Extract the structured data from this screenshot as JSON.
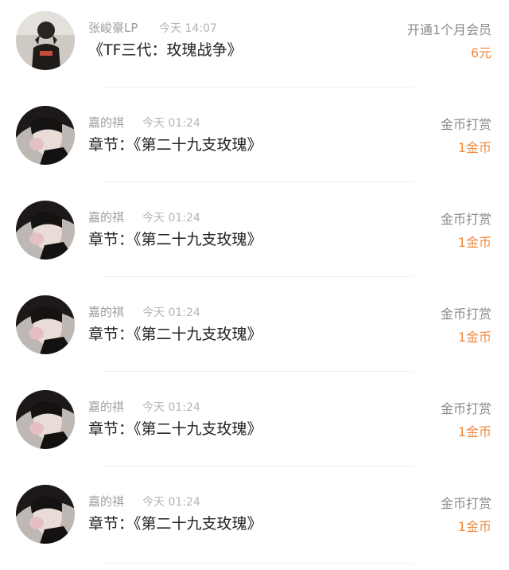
{
  "colors": {
    "name_text": "#9e9e9e",
    "time_text": "#b4b4b4",
    "desc_text": "#222222",
    "type_text": "#8a8a8a",
    "amount_accent": "#f08a3e",
    "divider": "#f0f0f0"
  },
  "records": [
    {
      "avatar": "user-avatar-icon",
      "name": "张峻豪LP",
      "time": "今天 14:07",
      "desc": "《TF三代：玫瑰战争》",
      "type": "开通1个月会员",
      "amount": "6元"
    },
    {
      "avatar": "user-avatar-icon",
      "name": "嘉的祺",
      "time": "今天 01:24",
      "desc": "章节：《第二十九支玫瑰》",
      "type": "金币打赏",
      "amount": "1金币"
    },
    {
      "avatar": "user-avatar-icon",
      "name": "嘉的祺",
      "time": "今天 01:24",
      "desc": "章节：《第二十九支玫瑰》",
      "type": "金币打赏",
      "amount": "1金币"
    },
    {
      "avatar": "user-avatar-icon",
      "name": "嘉的祺",
      "time": "今天 01:24",
      "desc": "章节：《第二十九支玫瑰》",
      "type": "金币打赏",
      "amount": "1金币"
    },
    {
      "avatar": "user-avatar-icon",
      "name": "嘉的祺",
      "time": "今天 01:24",
      "desc": "章节：《第二十九支玫瑰》",
      "type": "金币打赏",
      "amount": "1金币"
    },
    {
      "avatar": "user-avatar-icon",
      "name": "嘉的祺",
      "time": "今天 01:24",
      "desc": "章节：《第二十九支玫瑰》",
      "type": "金币打赏",
      "amount": "1金币"
    }
  ]
}
